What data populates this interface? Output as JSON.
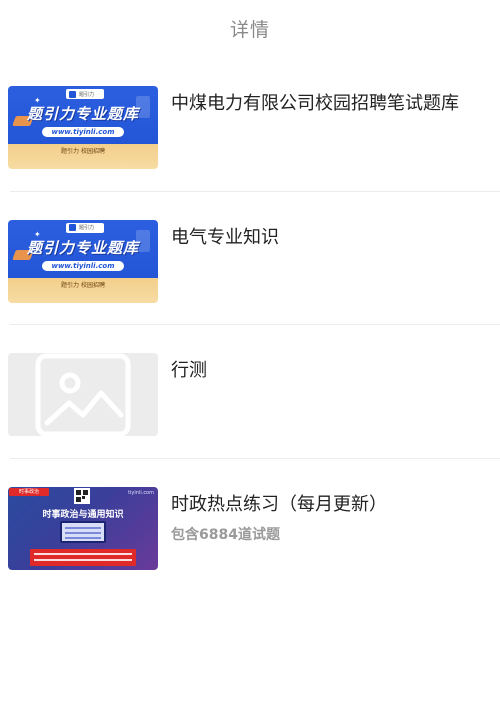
{
  "header": {
    "title": "详情"
  },
  "items": [
    {
      "title": "中煤电力有限公司校园招聘笔试题库",
      "thumbnail": {
        "type": "blue-banner",
        "title": "题引力专业题库",
        "url": "www.tiyinli.com",
        "tag": "题引力 校园招聘"
      }
    },
    {
      "title": "电气专业知识",
      "thumbnail": {
        "type": "blue-banner",
        "title": "题引力专业题库",
        "url": "www.tiyinli.com",
        "tag": "题引力 校园招聘"
      }
    },
    {
      "title": "行测",
      "thumbnail": {
        "type": "image-placeholder",
        "icon": "image-placeholder-icon"
      }
    },
    {
      "title": "时政热点练习（每月更新）",
      "subtitle": "包含6884道试题",
      "thumbnail": {
        "type": "purple-banner",
        "badge": "时事政治",
        "site": "tiyinli.com",
        "title": "时事政治与通用知识"
      }
    }
  ],
  "colors": {
    "divider": "#ececec",
    "header_text": "#8a8a8a",
    "title_text": "#222222",
    "subtitle_text": "#9a9a9a"
  }
}
